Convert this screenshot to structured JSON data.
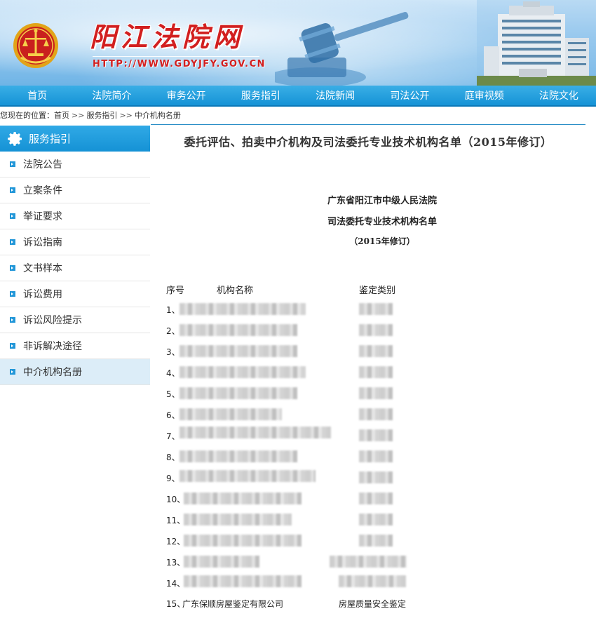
{
  "header": {
    "site_title": "阳江法院网",
    "site_url": "HTTP://WWW.GDYJFY.GOV.CN"
  },
  "nav": {
    "items": [
      "首页",
      "法院简介",
      "审务公开",
      "服务指引",
      "法院新闻",
      "司法公开",
      "庭审视频",
      "法院文化"
    ]
  },
  "breadcrumb": {
    "prefix": "您现在的位置：",
    "items": [
      "首页",
      "服务指引",
      "中介机构名册"
    ],
    "separator": ">>"
  },
  "sidebar": {
    "title": "服务指引",
    "items": [
      {
        "label": "法院公告"
      },
      {
        "label": "立案条件"
      },
      {
        "label": "举证要求"
      },
      {
        "label": "诉讼指南"
      },
      {
        "label": "文书样本"
      },
      {
        "label": "诉讼费用"
      },
      {
        "label": "诉讼风险提示"
      },
      {
        "label": "非诉解决途径"
      },
      {
        "label": "中介机构名册"
      }
    ],
    "active_index": 8
  },
  "article": {
    "title": "委托评估、拍卖中介机构及司法委托专业技术机构名单（2015年修订）",
    "court_name": "广东省阳江市中级人民法院",
    "list_name": "司法委托专业技术机构名单",
    "revision": "（2015年修订）",
    "columns": {
      "no": "序号",
      "name": "机构名称",
      "type": "鉴定类别"
    },
    "rows": [
      {
        "no": "1、"
      },
      {
        "no": "2、"
      },
      {
        "no": "3、"
      },
      {
        "no": "4、"
      },
      {
        "no": "5、"
      },
      {
        "no": "6、"
      },
      {
        "no": "7、"
      },
      {
        "no": "8、"
      },
      {
        "no": "9、"
      },
      {
        "no": "10、"
      },
      {
        "no": "11、"
      },
      {
        "no": "12、"
      },
      {
        "no": "13、"
      },
      {
        "no": "14、"
      },
      {
        "no": "15、",
        "name": "广东保顺房屋鉴定有限公司",
        "type": "房屋质量安全鉴定"
      }
    ]
  },
  "colors": {
    "nav_blue": "#1593d6",
    "title_red": "#d21f1f",
    "active_bg": "#dcedf8"
  }
}
